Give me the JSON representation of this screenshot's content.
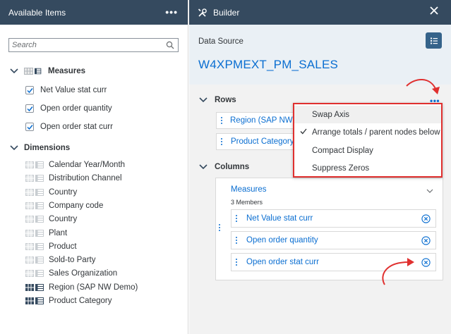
{
  "left_panel": {
    "title": "Available Items",
    "more_icon": "•••",
    "search": {
      "placeholder": "Search",
      "value": ""
    },
    "measures": {
      "label": "Measures",
      "items": [
        {
          "label": "Net Value stat curr",
          "checked": true
        },
        {
          "label": "Open order quantity",
          "checked": true
        },
        {
          "label": "Open order stat curr",
          "checked": true
        }
      ]
    },
    "dimensions": {
      "label": "Dimensions",
      "items": [
        {
          "label": "Calendar Year/Month",
          "in_use": false
        },
        {
          "label": "Distribution Channel",
          "in_use": false
        },
        {
          "label": "Country",
          "in_use": false
        },
        {
          "label": "Company code",
          "in_use": false
        },
        {
          "label": "Country",
          "in_use": false
        },
        {
          "label": "Plant",
          "in_use": false
        },
        {
          "label": "Product",
          "in_use": false
        },
        {
          "label": "Sold-to Party",
          "in_use": false
        },
        {
          "label": "Sales Organization",
          "in_use": false
        },
        {
          "label": "Region (SAP NW Demo)",
          "in_use": true
        },
        {
          "label": "Product Category",
          "in_use": true
        }
      ]
    }
  },
  "builder": {
    "title": "Builder",
    "data_source_label": "Data Source",
    "data_source_name": "W4XPMEXT_PM_SALES",
    "rows": {
      "label": "Rows",
      "more_icon": "•••",
      "items": [
        "Region (SAP NW Demo)",
        "Product Category"
      ]
    },
    "columns": {
      "label": "Columns",
      "measures_label": "Measures",
      "measures_count": "3 Members",
      "items": [
        "Net Value stat curr",
        "Open order quantity",
        "Open order stat curr"
      ]
    }
  },
  "context_menu": {
    "items": [
      {
        "label": "Swap Axis",
        "checked": false,
        "hovered": true
      },
      {
        "label": "Arrange totals / parent nodes below",
        "checked": true,
        "hovered": false
      },
      {
        "label": "Compact Display",
        "checked": false,
        "hovered": false
      },
      {
        "label": "Suppress Zeros",
        "checked": false,
        "hovered": false
      }
    ]
  },
  "colors": {
    "header_bg": "#354a5f",
    "link_blue": "#0a6ed1",
    "annotation_red": "#e0302f",
    "ds_block_bg": "#eaf0f5",
    "panel_bg": "#f2f2f2"
  },
  "icons": [
    "more-icon",
    "search-icon",
    "chevron-down-icon",
    "checkbox-checked-icon",
    "dimension-icon",
    "measure-icon",
    "wrench-icon",
    "close-icon",
    "list-settings-icon",
    "drag-handle-icon",
    "remove-icon",
    "checkmark-icon",
    "annotation-arrow"
  ]
}
